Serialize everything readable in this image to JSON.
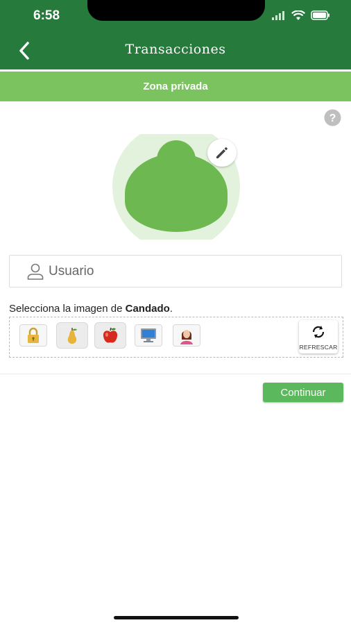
{
  "status": {
    "time": "6:58"
  },
  "header": {
    "title": "Transacciones",
    "back_icon": "chevron-left-icon"
  },
  "subbar": {
    "label": "Zona privada"
  },
  "help_icon": "question-circle-icon",
  "avatar": {
    "edit_icon": "pencil-icon"
  },
  "user_field": {
    "placeholder": "Usuario",
    "value": ""
  },
  "image_selection": {
    "instruction_prefix": "Selecciona la imagen de ",
    "instruction_target": "Candado",
    "instruction_suffix": ".",
    "options": [
      {
        "name": "padlock-image"
      },
      {
        "name": "pear-image"
      },
      {
        "name": "apple-image"
      },
      {
        "name": "computer-image"
      },
      {
        "name": "woman-image"
      }
    ],
    "refresh_label": "REFRESCAR"
  },
  "continue_label": "Continuar",
  "colors": {
    "primary_dark": "#257a3c",
    "primary_light": "#7ac35f",
    "button": "#5cb85c",
    "avatar_bg": "#e3f2dc",
    "avatar_fg": "#6db850"
  }
}
